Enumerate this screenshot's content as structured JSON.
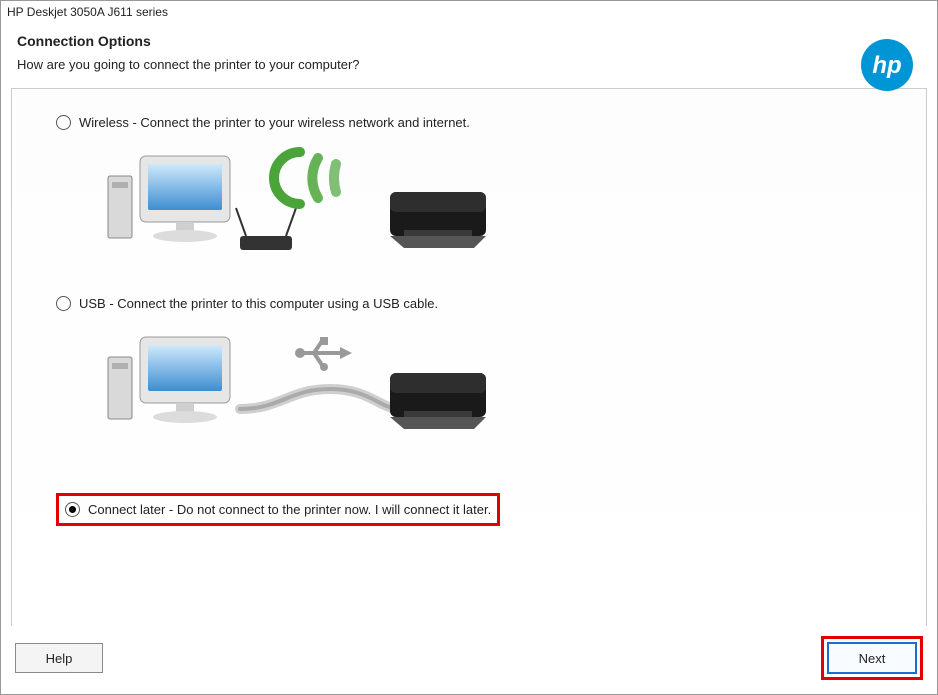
{
  "window_title": "HP Deskjet 3050A J611 series",
  "header": {
    "title": "Connection Options",
    "subtitle": "How are you going to connect the printer to your computer?"
  },
  "options": {
    "wireless": {
      "label": "Wireless - Connect the printer to your wireless network and internet.",
      "selected": false
    },
    "usb": {
      "label": "USB - Connect the printer to this computer using a USB cable.",
      "selected": false
    },
    "later": {
      "label": "Connect later - Do not connect to the printer now. I will connect it later.",
      "selected": true
    }
  },
  "buttons": {
    "help": "Help",
    "next": "Next"
  },
  "brand": {
    "logo_text": "hp",
    "primary_color": "#0096d6"
  }
}
